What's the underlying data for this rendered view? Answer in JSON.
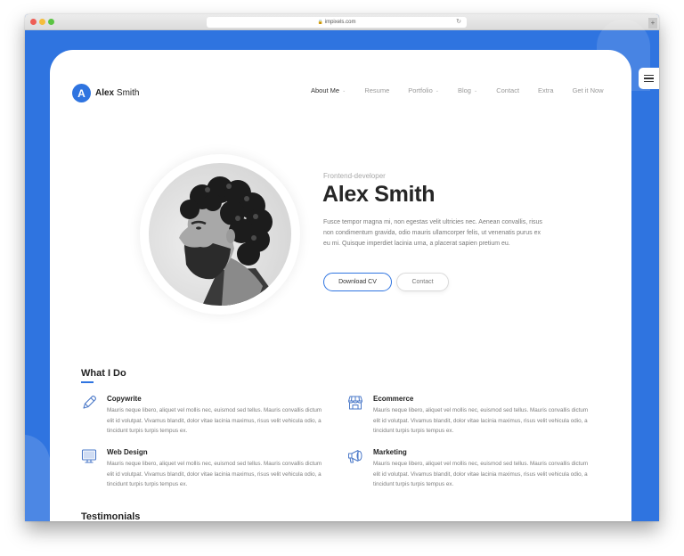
{
  "browser": {
    "url": "impixels.com",
    "new_tab_label": "+"
  },
  "header": {
    "logo_letter": "A",
    "logo_first": "Alex",
    "logo_last": "Smith",
    "nav": [
      {
        "label": "About Me",
        "has_dropdown": true,
        "active": true
      },
      {
        "label": "Resume",
        "has_dropdown": false,
        "active": false
      },
      {
        "label": "Portfolio",
        "has_dropdown": true,
        "active": false
      },
      {
        "label": "Blog",
        "has_dropdown": true,
        "active": false
      },
      {
        "label": "Contact",
        "has_dropdown": false,
        "active": false
      },
      {
        "label": "Extra",
        "has_dropdown": false,
        "active": false
      },
      {
        "label": "Get it Now",
        "has_dropdown": false,
        "active": false
      }
    ],
    "caret": "⌄"
  },
  "hero": {
    "role": "Frontend-developer",
    "name": "Alex Smith",
    "bio": "Fusce tempor magna mi, non egestas velit ultricies nec. Aenean convallis, risus non condimentum gravida, odio mauris ullamcorper felis, ut venenatis purus ex eu mi. Quisque imperdiet lacinia urna, a placerat sapien pretium eu.",
    "primary_button": "Download CV",
    "secondary_button": "Contact",
    "avatar_alt": "Portrait of Alex Smith"
  },
  "what_i_do": {
    "title": "What I Do",
    "services": [
      {
        "icon": "pencil-icon",
        "title": "Copywrite",
        "desc": "Mauris neque libero, aliquet vel mollis nec, euismod sed tellus. Mauris convallis dictum elit id volutpat. Vivamus blandit, dolor vitae lacinia maximus, risus velit vehicula odio, a tincidunt turpis turpis tempus ex."
      },
      {
        "icon": "store-icon",
        "title": "Ecommerce",
        "desc": "Mauris neque libero, aliquet vel mollis nec, euismod sed tellus. Mauris convallis dictum elit id volutpat. Vivamus blandit, dolor vitae lacinia maximus, risus velit vehicula odio, a tincidunt turpis turpis tempus ex."
      },
      {
        "icon": "monitor-icon",
        "title": "Web Design",
        "desc": "Mauris neque libero, aliquet vel mollis nec, euismod sed tellus. Mauris convallis dictum elit id volutpat. Vivamus blandit, dolor vitae lacinia maximus, risus velit vehicula odio, a tincidunt turpis turpis tempus ex."
      },
      {
        "icon": "megaphone-icon",
        "title": "Marketing",
        "desc": "Mauris neque libero, aliquet vel mollis nec, euismod sed tellus. Mauris convallis dictum elit id volutpat. Vivamus blandit, dolor vitae lacinia maximus, risus velit vehicula odio, a tincidunt turpis turpis tempus ex."
      }
    ]
  },
  "testimonials": {
    "title": "Testimonials"
  },
  "colors": {
    "accent": "#2f74e0",
    "heading": "#262626",
    "muted": "#7a7a7a",
    "icon": "#4a78c8"
  }
}
